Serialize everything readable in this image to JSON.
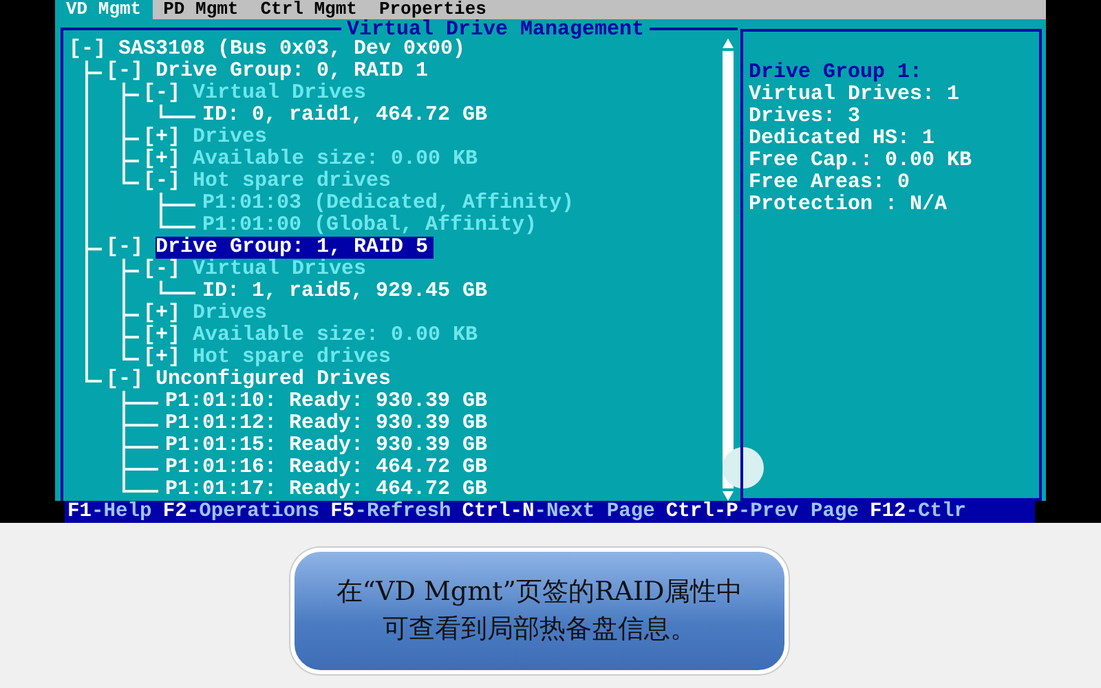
{
  "tabs": [
    {
      "label": "VD Mgmt",
      "selected": true
    },
    {
      "label": "PD Mgmt",
      "selected": false
    },
    {
      "label": "Ctrl Mgmt",
      "selected": false
    },
    {
      "label": "Properties",
      "selected": false
    }
  ],
  "panel_title": "Virtual Drive Management",
  "tree": {
    "toggle": "[-]",
    "label": "SAS3108 (Bus 0x03, Dev 0x00)",
    "kind": "node",
    "selected": false,
    "children": [
      {
        "toggle": "[-]",
        "label": "Drive Group: 0, RAID 1",
        "kind": "node",
        "selected": false,
        "children": [
          {
            "toggle": "[-]",
            "label": "Virtual Drives",
            "kind": "section",
            "selected": false,
            "children": [
              {
                "label": "ID: 0, raid1, 464.72 GB",
                "kind": "node",
                "selected": false
              }
            ]
          },
          {
            "toggle": "[+]",
            "label": "Drives",
            "kind": "section",
            "selected": false
          },
          {
            "toggle": "[+]",
            "label": "Available size: 0.00 KB",
            "kind": "section",
            "selected": false
          },
          {
            "toggle": "[-]",
            "label": "Hot spare drives",
            "kind": "section",
            "selected": false,
            "children": [
              {
                "label": "P1:01:03 (Dedicated, Affinity)",
                "kind": "section",
                "selected": false
              },
              {
                "label": "P1:01:00 (Global, Affinity)",
                "kind": "section",
                "selected": false
              }
            ]
          }
        ]
      },
      {
        "toggle": "[-]",
        "label": "Drive Group: 1, RAID 5",
        "kind": "node",
        "selected": true,
        "children": [
          {
            "toggle": "[-]",
            "label": "Virtual Drives",
            "kind": "section",
            "selected": false,
            "children": [
              {
                "label": "ID: 1, raid5, 929.45 GB",
                "kind": "node",
                "selected": false
              }
            ]
          },
          {
            "toggle": "[+]",
            "label": "Drives",
            "kind": "section",
            "selected": false
          },
          {
            "toggle": "[+]",
            "label": "Available size: 0.00 KB",
            "kind": "section",
            "selected": false
          },
          {
            "toggle": "[+]",
            "label": "Hot spare drives",
            "kind": "section",
            "selected": false
          }
        ]
      },
      {
        "toggle": "[-]",
        "label": "Unconfigured Drives",
        "kind": "node",
        "selected": false,
        "children": [
          {
            "label": "P1:01:10: Ready: 930.39 GB",
            "kind": "node",
            "selected": false
          },
          {
            "label": "P1:01:12: Ready: 930.39 GB",
            "kind": "node",
            "selected": false
          },
          {
            "label": "P1:01:15: Ready: 930.39 GB",
            "kind": "node",
            "selected": false
          },
          {
            "label": "P1:01:16: Ready: 464.72 GB",
            "kind": "node",
            "selected": false
          },
          {
            "label": "P1:01:17: Ready: 464.72 GB",
            "kind": "node",
            "selected": false
          }
        ]
      }
    ]
  },
  "details": {
    "title": "Drive Group 1:",
    "lines": [
      "Virtual Drives: 1",
      "Drives: 3",
      "Dedicated HS: 1",
      "Free Cap.: 0.00 KB",
      "Free Areas: 0",
      "Protection : N/A"
    ]
  },
  "keys": [
    {
      "key": "F1",
      "action": "-Help"
    },
    {
      "key": "F2",
      "action": "-Operations"
    },
    {
      "key": "F5",
      "action": "-Refresh"
    },
    {
      "key": "Ctrl-N",
      "action": "-Next Page"
    },
    {
      "key": "Ctrl-P",
      "action": "-Prev Page"
    },
    {
      "key": "F12",
      "action": "-Ctlr"
    }
  ],
  "caption": [
    "在“VD Mgmt”页签的RAID属性中",
    "可查看到局部热备盘信息。"
  ]
}
